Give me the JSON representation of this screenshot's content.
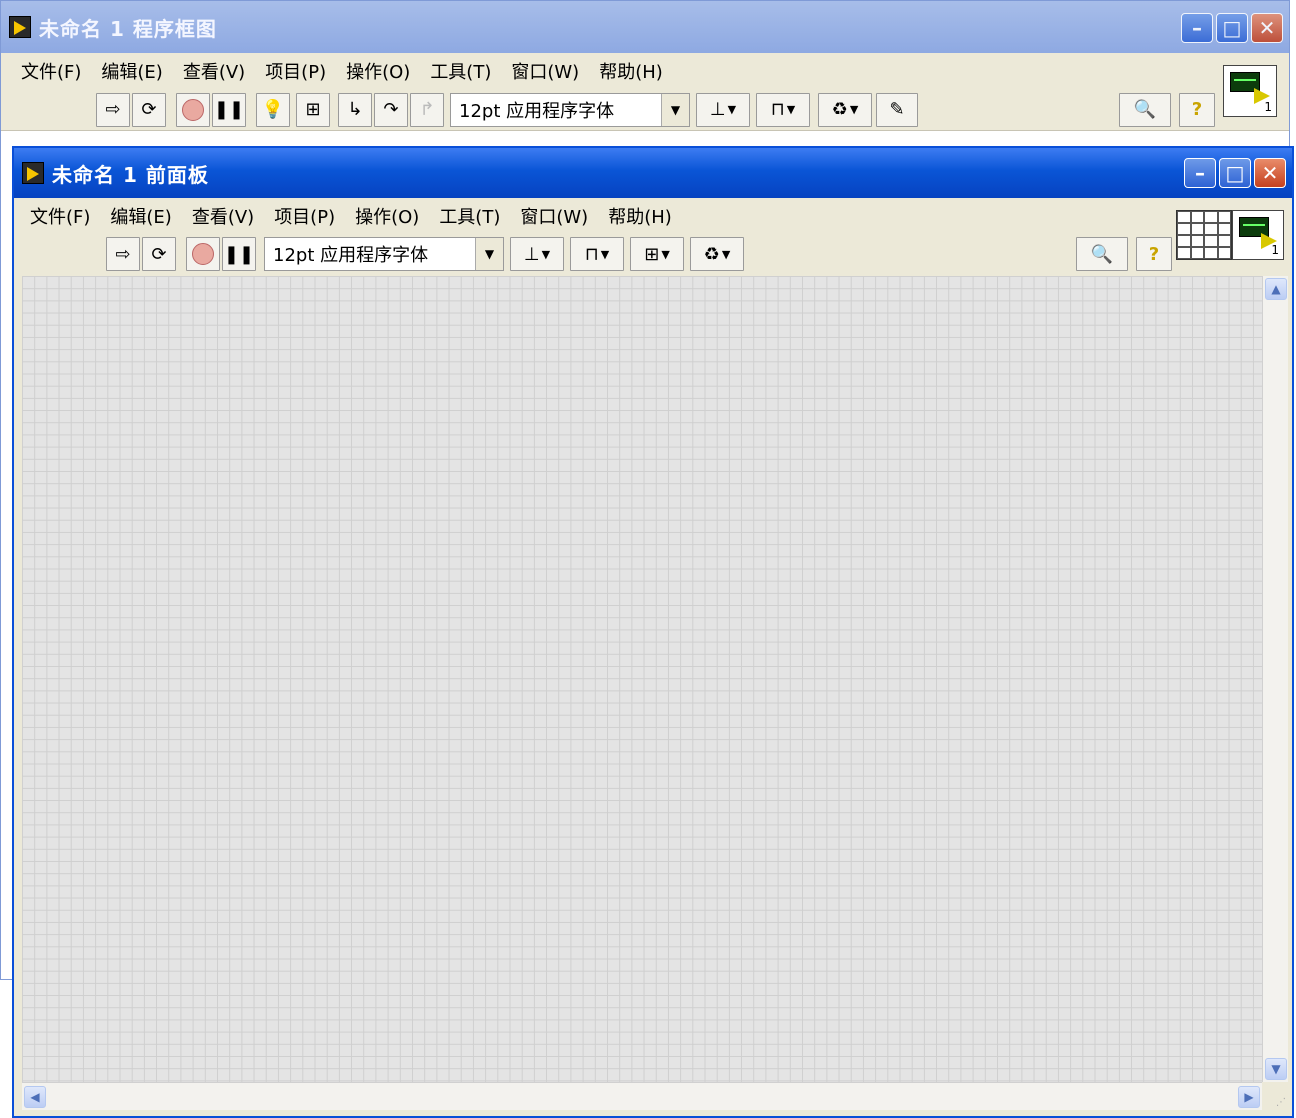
{
  "back_window": {
    "title": "未命名 1 程序框图",
    "menu": [
      "文件(F)",
      "编辑(E)",
      "查看(V)",
      "项目(P)",
      "操作(O)",
      "工具(T)",
      "窗口(W)",
      "帮助(H)"
    ],
    "font_select": "12pt 应用程序字体",
    "vi_icon_number": "1"
  },
  "front_window": {
    "title": "未命名 1 前面板",
    "menu": [
      "文件(F)",
      "编辑(E)",
      "查看(V)",
      "项目(P)",
      "操作(O)",
      "工具(T)",
      "窗口(W)",
      "帮助(H)"
    ],
    "font_select": "12pt 应用程序字体",
    "vi_icon_number": "1"
  },
  "window_buttons": {
    "minimize": "–",
    "maximize": "□",
    "close": "✕"
  }
}
